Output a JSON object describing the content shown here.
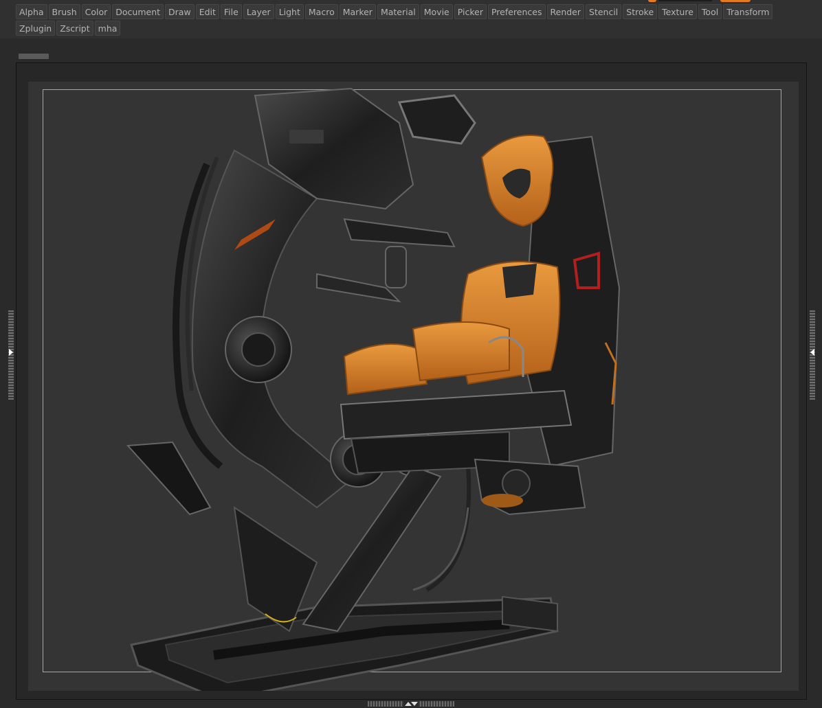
{
  "menu": {
    "row1": [
      "Alpha",
      "Brush",
      "Color",
      "Document",
      "Draw",
      "Edit",
      "File",
      "Layer",
      "Light",
      "Macro",
      "Marker",
      "Material",
      "Movie",
      "Picker",
      "Preferences",
      "Render",
      "Stencil",
      "Stroke",
      "Texture",
      "Tool",
      "Transform"
    ],
    "row2": [
      "Zplugin",
      "Zscript",
      "mha"
    ]
  },
  "colors": {
    "accent": "#e67a1e",
    "seat_orange": "#d67e22",
    "panel_bg": "#303030",
    "canvas_bg": "#343434"
  },
  "icons": {
    "left_tray": "chevron-right-icon",
    "right_tray": "chevron-left-icon",
    "bottom_tray": "up-down-arrows-icon"
  }
}
